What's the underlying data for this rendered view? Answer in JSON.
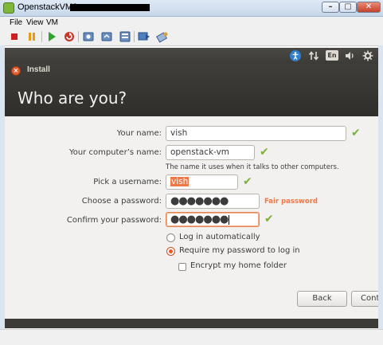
{
  "window": {
    "title": "OpenstackVM3 on",
    "minimize": "–",
    "maximize": "▢",
    "close": "✕"
  },
  "menu": {
    "file": "File",
    "view": "View",
    "vm": "VM"
  },
  "toolbar": {
    "icons": [
      "stop-icon",
      "pause-icon",
      "play-icon",
      "reset-icon",
      "snapshot-icon",
      "revert-snapshot-icon",
      "snapshot-manager-icon",
      "fullscreen-icon",
      "preferences-icon"
    ]
  },
  "panel": {
    "language": "En"
  },
  "dialog": {
    "title": "Install",
    "heading": "Who are you?"
  },
  "form": {
    "name_label": "Your name:",
    "name_value": "vish",
    "computer_label": "Your computer’s name:",
    "computer_value": "openstack-vm",
    "computer_hint": "The name it uses when it talks to other computers.",
    "username_label": "Pick a username:",
    "username_value": "vish",
    "password_label": "Choose a password:",
    "password_value": "●●●●●●●",
    "password_strength": "Fair password",
    "confirm_label": "Confirm your password:",
    "confirm_value": "●●●●●●●",
    "option_auto_login": "Log in automatically",
    "option_require_password": "Require my password to log in",
    "option_encrypt_home": "Encrypt my home folder",
    "selected_option": "Require my password to log in",
    "encrypt_checked": false
  },
  "buttons": {
    "back": "Back",
    "continue": "Conti"
  },
  "colors": {
    "accent": "#f07746",
    "check": "#7bb13c",
    "header_bg": "#3c3b37"
  }
}
